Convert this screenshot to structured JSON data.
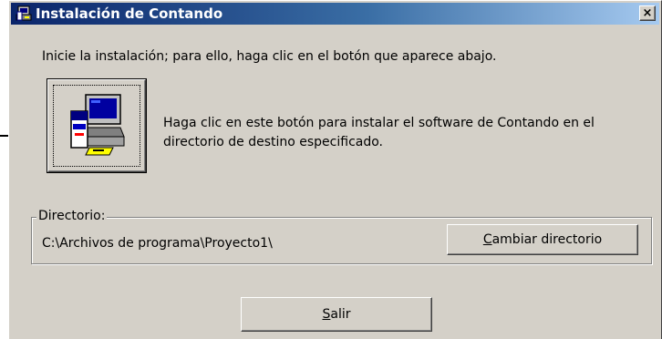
{
  "window": {
    "title": "Instalación de Contando",
    "close_label": "×"
  },
  "instruction": "Inicie la instalación; para ello, haga clic en el botón que aparece abajo.",
  "install": {
    "description": "Haga clic en este botón para instalar el software de Contando en el directorio de destino especificado."
  },
  "directory": {
    "group_label": "Directorio:",
    "path": "C:\\Archivos de programa\\Proyecto1\\",
    "change_button": {
      "mnemonic": "C",
      "rest": "ambiar directorio"
    }
  },
  "exit_button": {
    "mnemonic": "S",
    "rest": "alir"
  }
}
